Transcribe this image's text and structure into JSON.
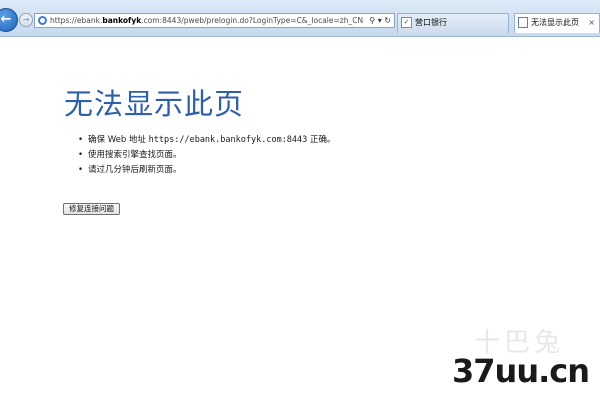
{
  "browser": {
    "address": {
      "url_prefix": "https://ebank.",
      "url_host": "bankofyk",
      "url_suffix": ".com:8443/pweb/prelogin.do?LoginType=C&_locale=zh_CN",
      "controls": "⚲ ▾ ↻"
    },
    "tabs": [
      {
        "label": "营口银行",
        "icon": "checkbox-icon"
      },
      {
        "label": "无法显示此页",
        "icon": "page-icon",
        "close": "×"
      }
    ]
  },
  "page": {
    "title": "无法显示此页",
    "tips": [
      {
        "bullet": "•",
        "text_a": "确保 Web 地址 ",
        "mono": "https://ebank.bankofyk.com:8443",
        "text_b": " 正确。"
      },
      {
        "bullet": "•",
        "text_a": "使用搜索引擎查找页面。",
        "mono": "",
        "text_b": ""
      },
      {
        "bullet": "•",
        "text_a": "请过几分钟后刷新页面。",
        "mono": "",
        "text_b": ""
      }
    ],
    "fix_button": "修复连接问题"
  },
  "watermark": {
    "top_text": "十巴兔",
    "main_text": "37uu.cn"
  }
}
